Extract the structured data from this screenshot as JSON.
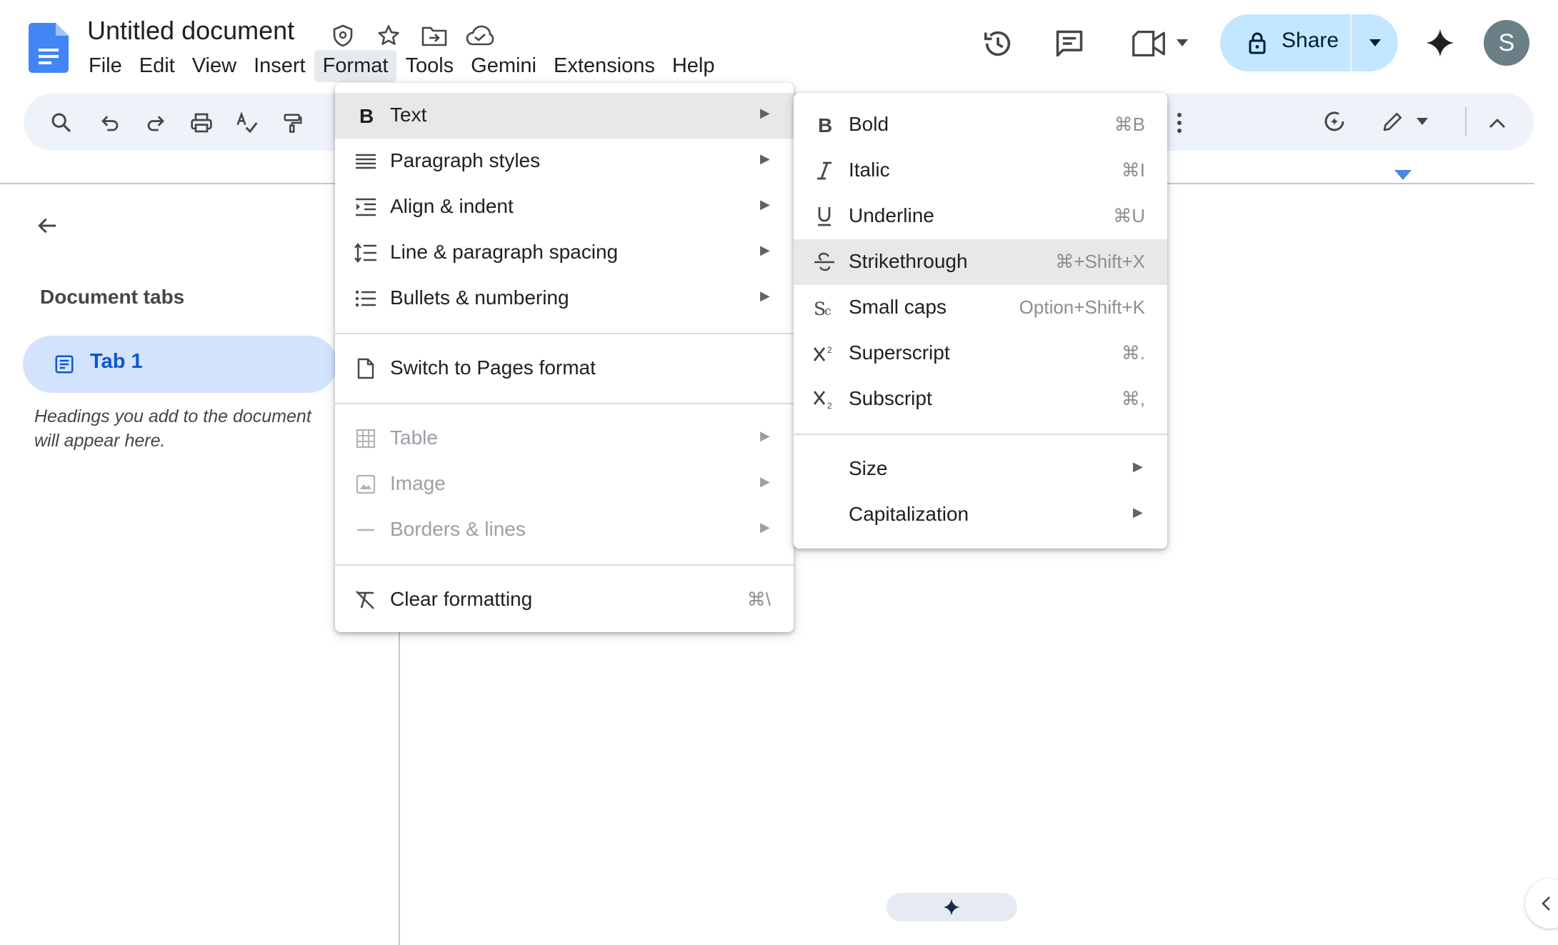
{
  "app": {
    "title": "Untitled document",
    "menus": [
      "File",
      "Edit",
      "View",
      "Insert",
      "Format",
      "Tools",
      "Gemini",
      "Extensions",
      "Help"
    ],
    "active_menu": "Format"
  },
  "header": {
    "share_label": "Share",
    "avatar_initial": "S"
  },
  "sidebar": {
    "heading": "Document tabs",
    "tab_label": "Tab 1",
    "note": "Headings you add to the document will appear here."
  },
  "format_menu": {
    "text": "Text",
    "paragraph_styles": "Paragraph styles",
    "align_indent": "Align & indent",
    "line_spacing": "Line & paragraph spacing",
    "bullets": "Bullets & numbering",
    "switch_pages": "Switch to Pages format",
    "table": "Table",
    "image": "Image",
    "borders": "Borders & lines",
    "clear_formatting": "Clear formatting",
    "clear_shortcut": "⌘\\",
    "submenu_arrow": "▶"
  },
  "text_menu": {
    "bold": "Bold",
    "bold_shortcut": "⌘B",
    "italic": "Italic",
    "italic_shortcut": "⌘I",
    "underline": "Underline",
    "underline_shortcut": "⌘U",
    "strikethrough": "Strikethrough",
    "strikethrough_shortcut": "⌘+Shift+X",
    "small_caps": "Small caps",
    "small_caps_shortcut": "Option+Shift+K",
    "superscript": "Superscript",
    "superscript_shortcut": "⌘.",
    "subscript": "Subscript",
    "subscript_shortcut": "⌘,",
    "size": "Size",
    "capitalization": "Capitalization"
  },
  "icons": {
    "doc_icon_color": "#4285f4",
    "accent": "#0b57d0",
    "share_bg": "#c2e7ff",
    "gemini_spark": "✦"
  }
}
